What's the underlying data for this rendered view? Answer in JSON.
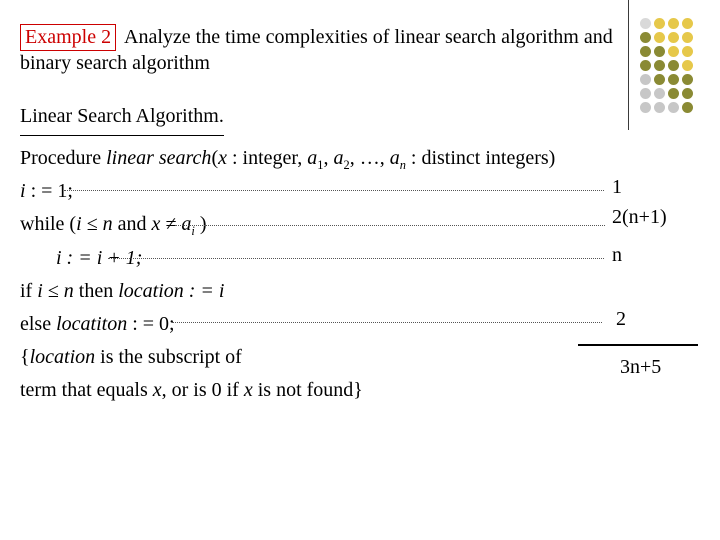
{
  "deco_colors": [
    "#d9d9d9",
    "#e6c84a",
    "#e6c84a",
    "#e6c84a",
    "#8a8a34",
    "#e6c84a",
    "#e6c84a",
    "#e6c84a",
    "#8a8a34",
    "#8a8a34",
    "#e6c84a",
    "#e6c84a",
    "#8a8a34",
    "#8a8a34",
    "#8a8a34",
    "#e6c84a",
    "#c7c7c7",
    "#8a8a34",
    "#8a8a34",
    "#8a8a34",
    "#c7c7c7",
    "#c7c7c7",
    "#8a8a34",
    "#8a8a34",
    "#c7c7c7",
    "#c7c7c7",
    "#c7c7c7",
    "#8a8a34"
  ],
  "header": {
    "example_label": "Example 2",
    "text": "Analyze the time complexities of linear search algorithm and binary search algorithm"
  },
  "algo": {
    "title": "Linear Search Algorithm.",
    "proc_prefix": "Procedure ",
    "proc_name": "linear search",
    "proc_open": "(",
    "x": "x",
    "integer": " : integer, ",
    "a1": "a",
    "s1": "1",
    "comma12": ", ",
    "a2": "a",
    "s2": "2",
    "dots": ", …, ",
    "an": "a",
    "sn": "n",
    "distinct": " : distinct integers)",
    "l1_a": "i",
    "l1_b": ": = 1;",
    "l2_a": "while (",
    "l2_b": "i ≤ n",
    "l2_c": " and ",
    "l2_d": "x ≠ a",
    "l2_sub": "i",
    "l2_e": " )",
    "l3_a": "i : = i + 1;",
    "l4_a": "if ",
    "l4_b": "i ≤ n",
    "l4_c": " then ",
    "l4_d": "location : = i",
    "l5_a": "else ",
    "l5_b": "locatiton",
    "l5_c": " : = 0;",
    "l6_a": "{",
    "l6_b": "location",
    "l6_c": " is the subscript of",
    "l7_a": "term that equals ",
    "l7_b": "x",
    "l7_c": ", or is 0 if ",
    "l7_d": "x",
    "l7_e": " is not found}"
  },
  "annotations": {
    "a1": "1",
    "a2": "2(n+1)",
    "a3": "n",
    "a4": "2",
    "a5": "3n+5"
  }
}
